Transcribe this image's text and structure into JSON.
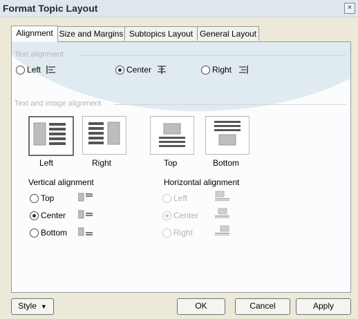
{
  "window": {
    "title": "Format Topic Layout",
    "close_glyph": "×"
  },
  "tabs": [
    {
      "label": "Alignment",
      "active": true
    },
    {
      "label": "Size and Margins"
    },
    {
      "label": "Subtopics Layout"
    },
    {
      "label": "General Layout"
    }
  ],
  "text_alignment": {
    "title": "Text alignment",
    "options": [
      {
        "label": "Left",
        "selected": false,
        "icon": "align-left-icon"
      },
      {
        "label": "Center",
        "selected": true,
        "icon": "align-center-icon"
      },
      {
        "label": "Right",
        "selected": false,
        "icon": "align-right-icon"
      }
    ]
  },
  "text_image_alignment": {
    "title": "Text and image alignment",
    "tiles": [
      {
        "label": "Left",
        "selected": true
      },
      {
        "label": "Right",
        "selected": false
      },
      {
        "label": "Top",
        "selected": false
      },
      {
        "label": "Bottom",
        "selected": false
      }
    ],
    "vertical": {
      "title": "Vertical alignment",
      "options": [
        {
          "label": "Top",
          "selected": false
        },
        {
          "label": "Center",
          "selected": true
        },
        {
          "label": "Bottom",
          "selected": false
        }
      ]
    },
    "horizontal": {
      "title": "Horizontal alignment",
      "enabled": false,
      "options": [
        {
          "label": "Left",
          "selected": false
        },
        {
          "label": "Center",
          "selected": true
        },
        {
          "label": "Right",
          "selected": false
        }
      ]
    }
  },
  "footer": {
    "style_label": "Style",
    "style_arrow": "▼",
    "ok_label": "OK",
    "cancel_label": "Cancel",
    "apply_label": "Apply"
  }
}
